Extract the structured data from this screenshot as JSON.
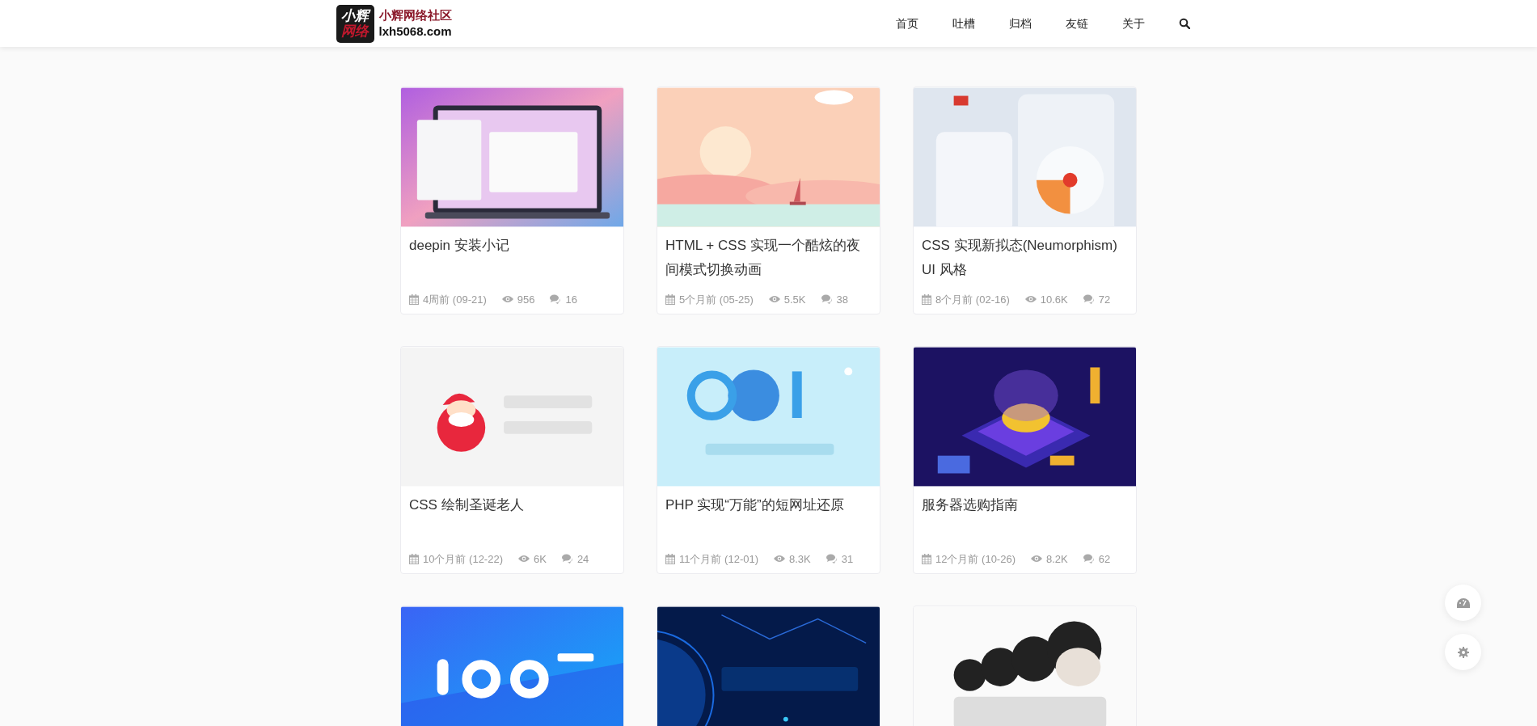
{
  "header": {
    "logo": {
      "mark": [
        "小辉",
        "网络"
      ],
      "name": "小辉网络社区",
      "domain": "lxh5068.com"
    },
    "nav": [
      {
        "label": "首页"
      },
      {
        "label": "吐槽"
      },
      {
        "label": "归档"
      },
      {
        "label": "友链"
      },
      {
        "label": "关于"
      }
    ]
  },
  "posts": [
    {
      "kind": "post",
      "title": "deepin 安装小记",
      "date": "4周前 (09-21)",
      "views": "956",
      "comments": "16"
    },
    {
      "kind": "post",
      "title": "HTML + CSS 实现一个酷炫的夜间模式切换动画",
      "date": "5个月前 (05-25)",
      "views": "5.5K",
      "comments": "38"
    },
    {
      "kind": "post",
      "title": "CSS 实现新拟态(Neumorphism) UI 风格",
      "date": "8个月前 (02-16)",
      "views": "10.6K",
      "comments": "72"
    },
    {
      "kind": "post",
      "title": "CSS 绘制圣诞老人",
      "date": "10个月前 (12-22)",
      "views": "6K",
      "comments": "24"
    },
    {
      "kind": "post",
      "title": "PHP 实现“万能”的短网址还原",
      "date": "11个月前 (12-01)",
      "views": "8.3K",
      "comments": "31"
    },
    {
      "kind": "post",
      "title": "服务器选购指南",
      "date": "12个月前 (10-26)",
      "views": "8.2K",
      "comments": "62"
    },
    {
      "kind": "picture"
    },
    {
      "kind": "picture"
    },
    {
      "kind": "picture"
    }
  ]
}
